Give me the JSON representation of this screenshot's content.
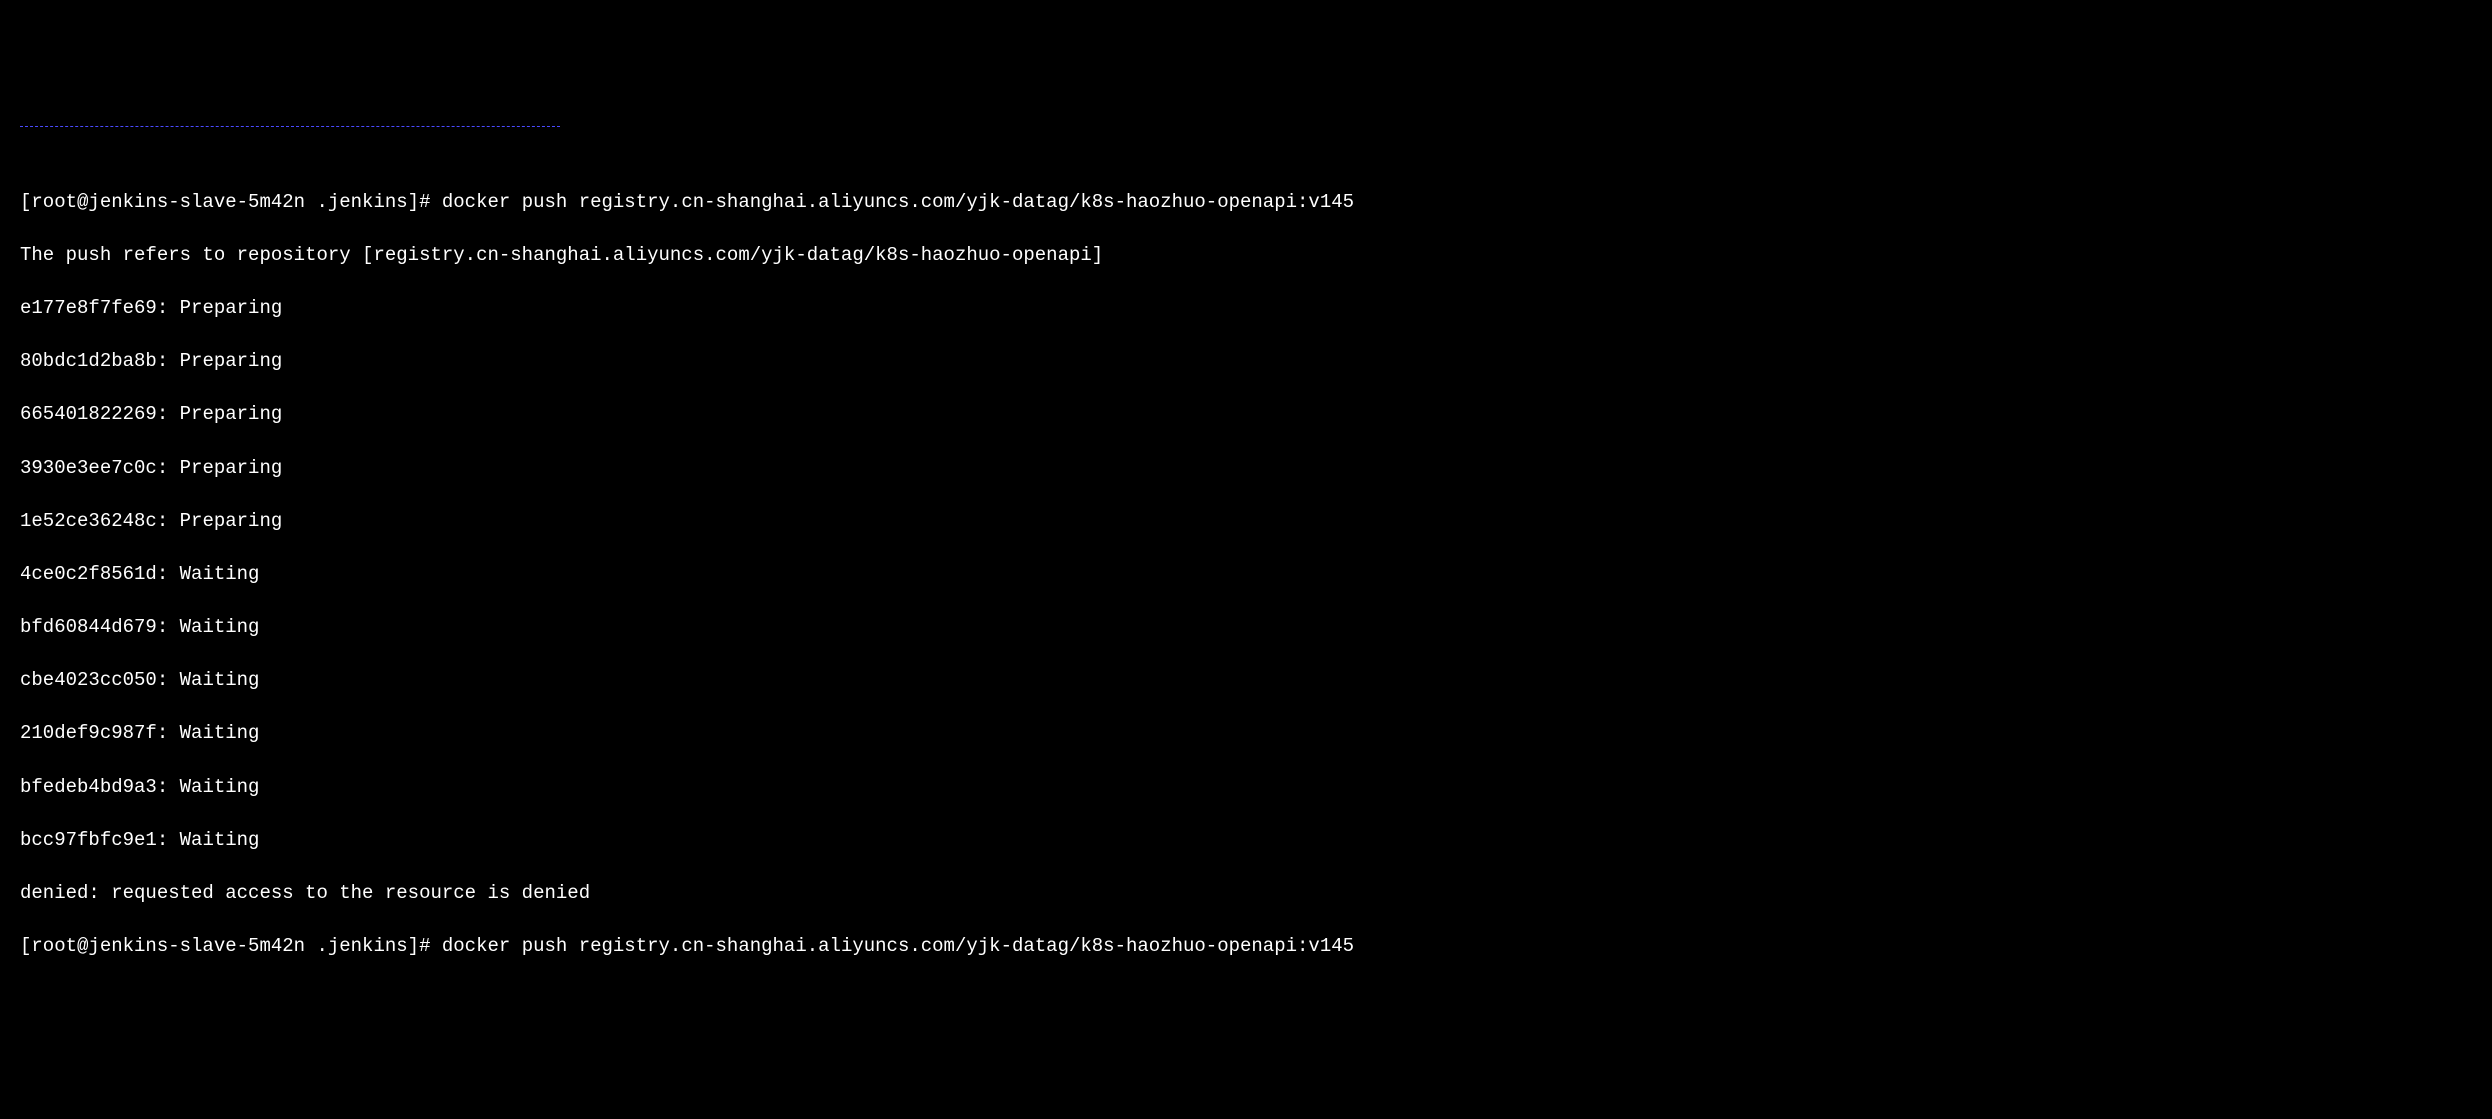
{
  "terminal": {
    "line1_prompt": "[root@jenkins-slave-5m42n .jenkins]# ",
    "line1_command": "docker push registry.cn-shanghai.aliyuncs.com/yjk-datag/k8s-haozhuo-openapi:v145",
    "line2": "The push refers to repository [registry.cn-shanghai.aliyuncs.com/yjk-datag/k8s-haozhuo-openapi]",
    "layers": [
      {
        "id": "e177e8f7fe69",
        "status": "Preparing"
      },
      {
        "id": "80bdc1d2ba8b",
        "status": "Preparing"
      },
      {
        "id": "665401822269",
        "status": "Preparing"
      },
      {
        "id": "3930e3ee7c0c",
        "status": "Preparing"
      },
      {
        "id": "1e52ce36248c",
        "status": "Preparing"
      },
      {
        "id": "4ce0c2f8561d",
        "status": "Waiting"
      },
      {
        "id": "bfd60844d679",
        "status": "Waiting"
      },
      {
        "id": "cbe4023cc050",
        "status": "Waiting"
      },
      {
        "id": "210def9c987f",
        "status": "Waiting"
      },
      {
        "id": "bfedeb4bd9a3",
        "status": "Waiting"
      },
      {
        "id": "bcc97fbfc9e1",
        "status": "Waiting"
      }
    ],
    "error_line": "denied: requested access to the resource is denied",
    "line_last_prompt": "[root@jenkins-slave-5m42n .jenkins]# ",
    "line_last_command": "docker push registry.cn-shanghai.aliyuncs.com/yjk-datag/k8s-haozhuo-openapi:v145"
  }
}
